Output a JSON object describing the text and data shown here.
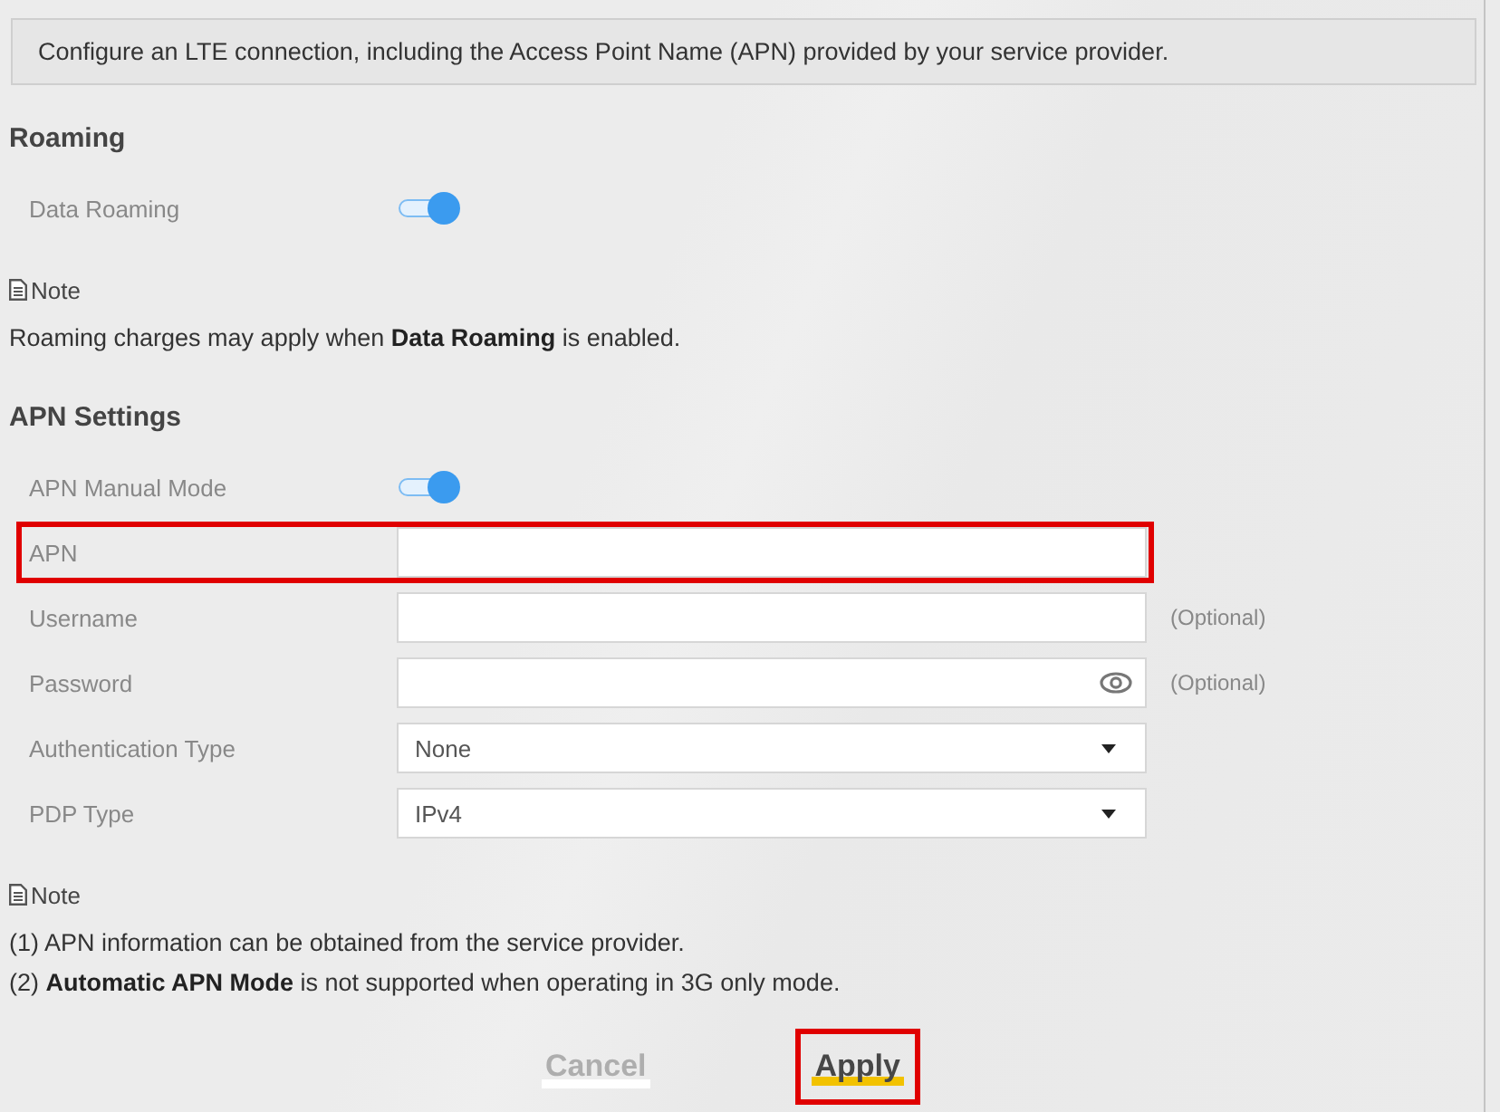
{
  "intro": "Configure an LTE connection, including the Access Point Name (APN) provided by your service provider.",
  "sections": [
    {
      "title": "Roaming",
      "fields": [
        {
          "kind": "toggle",
          "label": "Data Roaming",
          "on": true,
          "highlighted": false
        }
      ],
      "note": {
        "title": "Note",
        "lines": [
          "Roaming charges may apply when **Data Roaming** is enabled."
        ]
      }
    },
    {
      "title": "APN Settings",
      "fields": [
        {
          "kind": "toggle",
          "label": "APN Manual Mode",
          "on": true,
          "highlighted": false
        },
        {
          "kind": "text",
          "label": "APN",
          "highlighted": true
        },
        {
          "kind": "text",
          "label": "Username",
          "hint": "(Optional)",
          "highlighted": false
        },
        {
          "kind": "password",
          "label": "Password",
          "hint": "(Optional)",
          "highlighted": false
        },
        {
          "kind": "select",
          "label": "Authentication Type",
          "value": "None",
          "highlighted": false
        },
        {
          "kind": "select",
          "label": "PDP Type",
          "value": "IPv4",
          "highlighted": false
        }
      ],
      "note": {
        "title": "Note",
        "lines": [
          "(1) APN information can be obtained from the service provider.",
          "(2) **Automatic APN Mode** is not supported when operating in 3G only mode."
        ]
      }
    }
  ],
  "buttons": [
    {
      "label": "Cancel",
      "kind": "secondary",
      "highlighted": false
    },
    {
      "label": "Apply",
      "kind": "primary",
      "highlighted": true
    }
  ]
}
